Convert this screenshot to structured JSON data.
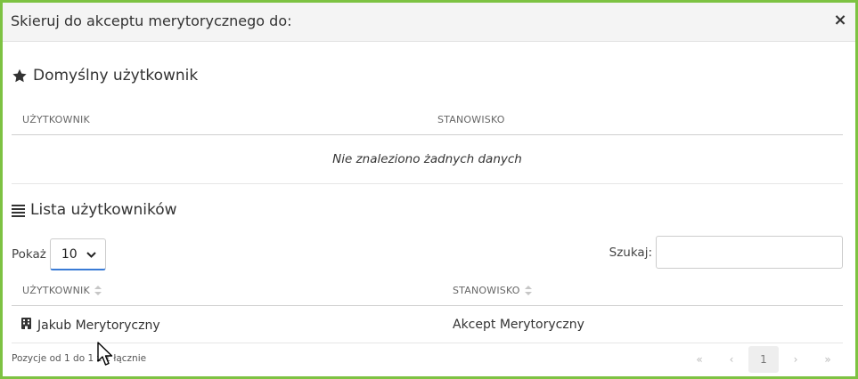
{
  "dialog": {
    "title": "Skieruj do akceptu merytorycznego do:",
    "close_label": "×"
  },
  "default_user": {
    "heading": "Domyślny użytkownik",
    "columns": [
      "UŻYTKOWNIK",
      "STANOWISKO"
    ],
    "empty_message": "Nie znaleziono żadnych danych"
  },
  "user_list": {
    "heading": "Lista użytkowników",
    "show_label": "Pokaż",
    "page_size": "10",
    "search_label": "Szukaj:",
    "search_value": "",
    "columns": [
      "UŻYTKOWNIK",
      "STANOWISKO"
    ],
    "rows": [
      {
        "user": "Jakub Merytoryczny",
        "position": "Akcept Merytoryczny"
      }
    ],
    "info_text": "Pozycje od 1 do 1 z 1 łącznie",
    "pagination": {
      "first": "«",
      "prev": "‹",
      "current": "1",
      "next": "›",
      "last": "»"
    }
  },
  "colors": {
    "frame_border": "#7dc242",
    "select_underline": "#3a7bd5"
  }
}
